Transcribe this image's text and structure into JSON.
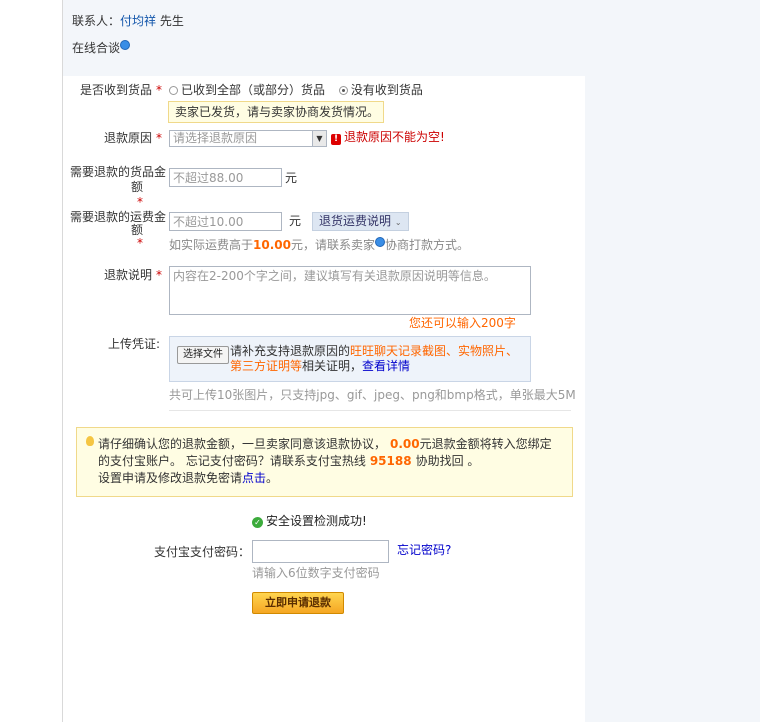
{
  "contact": {
    "label": "联系人：",
    "name": "付均祥",
    "title": "先生",
    "chat": "在线合谈"
  },
  "received": {
    "label": "是否收到货品",
    "required": "*",
    "option1": "已收到全部（或部分）货品",
    "option2": "没有收到货品",
    "notice": "卖家已发货，请与卖家协商发货情况。"
  },
  "reason": {
    "label": "退款原因",
    "required": "*",
    "placeholder": "请选择退款原因",
    "error": "退款原因不能为空!"
  },
  "goods_amount": {
    "label_line1": "需要退款的货品金",
    "label_line2": "额",
    "required": "*",
    "placeholder": "不超过88.00",
    "unit": "元"
  },
  "shipping_amount": {
    "label_line1": "需要退款的运费金",
    "label_line2": "额",
    "required": "*",
    "placeholder": "不超过10.00",
    "unit": "元",
    "button": "退货运费说明",
    "note_prefix": "如实际运费高于",
    "note_value": "10.00",
    "note_middle": "元，请联系卖家",
    "note_suffix": "协商打款方式。"
  },
  "description": {
    "label": "退款说明",
    "required": "*",
    "placeholder": "内容在2-200个字之间，建议填写有关退款原因说明等信息。",
    "remaining": "您还可以输入200字"
  },
  "upload": {
    "label": "上传凭证:",
    "button": "选择文件",
    "text_prefix": "请补充支持退款原因的",
    "text_highlight1": "旺旺聊天记录截图、实物照片、第三方证明等",
    "text_middle": "相关证明，",
    "link": "查看详情",
    "hint": "共可上传10张图片，只支持jpg、gif、jpeg、png和bmp格式，单张最大5M"
  },
  "confirm": {
    "line1_prefix": "请仔细确认您的退款金额，一旦卖家同意该退款协议，",
    "amount": "0.00",
    "line1_suffix": "元退款金额将转入您绑定",
    "line2_prefix": "的支付宝账户。 忘记支付密码？请联系支付宝热线",
    "hotline": "95188",
    "line2_suffix": "协助找回 。",
    "line3_prefix": "设置申请及修改退款免密请",
    "line3_link": "点击",
    "line3_suffix": "。"
  },
  "security": {
    "text": "安全设置检测成功!"
  },
  "password": {
    "label": "支付宝支付密码：",
    "forgot": "忘记密码?",
    "hint": "请输入6位数字支付密码"
  },
  "submit": {
    "label": "立即申请退款"
  }
}
